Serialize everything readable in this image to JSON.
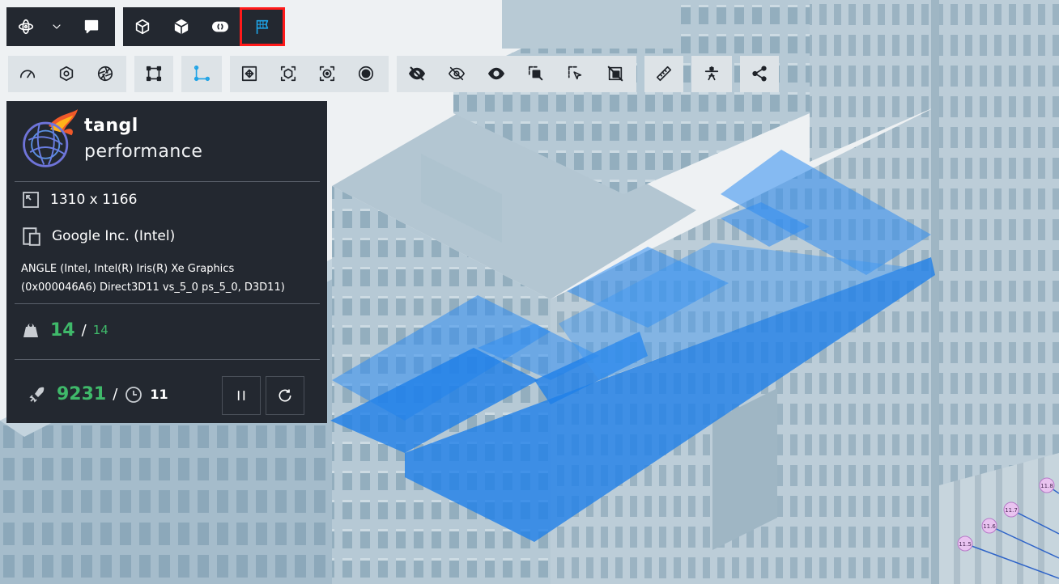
{
  "toolbar_top": {
    "items": [
      {
        "name": "orbit-mode-icon"
      },
      {
        "name": "chevron-down-icon"
      },
      {
        "name": "comment-icon"
      },
      {
        "name": "wireframe-box-icon"
      },
      {
        "name": "solid-box-icon"
      },
      {
        "name": "toggle-pill-icon"
      },
      {
        "name": "flag-icon",
        "active": true,
        "selected": true
      }
    ]
  },
  "toolbar_second": {
    "groups": [
      [
        "speedometer-icon",
        "hexagon-nut-icon",
        "aperture-icon"
      ],
      [
        "bounding-frame-icon"
      ],
      [
        "axes-icon"
      ],
      [
        "fit-view-icon",
        "focus-box-icon",
        "focus-target-icon",
        "record-circle-icon"
      ],
      [
        "hide-eye-filled-icon",
        "hide-eye-outline-icon",
        "show-eye-icon",
        "select-area-icon",
        "select-cursor-icon",
        "isolate-icon"
      ],
      [
        "ruler-icon"
      ],
      [
        "section-plane-icon"
      ],
      [
        "share-icon"
      ]
    ]
  },
  "performance": {
    "title": "tangl",
    "subtitle": "performance",
    "resolution": "1310 x 1166",
    "vendor": "Google Inc. (Intel)",
    "renderer_line1": "ANGLE (Intel, Intel(R) Iris(R) Xe Graphics",
    "renderer_line2": "(0x000046A6) Direct3D11 vs_5_0 ps_5_0, D3D11)",
    "loaded": "14",
    "total": "14",
    "triangles": "9231",
    "draw_time": "11"
  },
  "scene_labels": [
    "11.8",
    "11.7",
    "11.6",
    "11.5"
  ],
  "colors": {
    "panel_bg": "#232830",
    "accent_green": "#3fb96a",
    "accent_blue": "#1ea3e6",
    "selection_red": "#ff1a1a",
    "building": "#a9bfcc",
    "highlight": "#2f8cf0"
  }
}
